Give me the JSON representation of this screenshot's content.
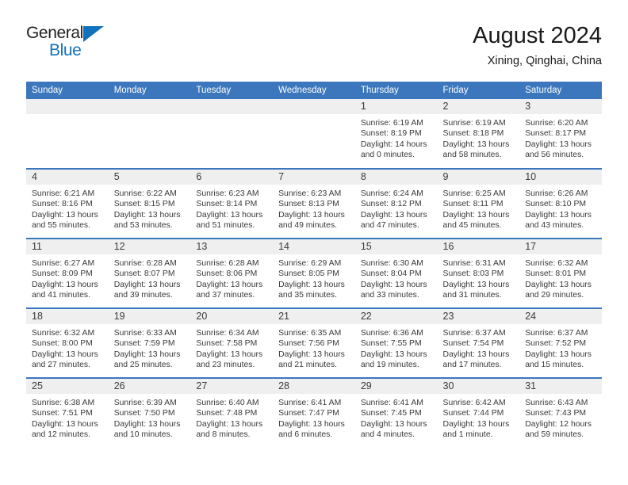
{
  "brand": {
    "name_line1": "General",
    "name_line2": "Blue",
    "accent_color": "#1272bc"
  },
  "header": {
    "title": "August 2024",
    "location": "Xining, Qinghai, China"
  },
  "theme": {
    "header_blue": "#3c77bd",
    "daynum_band": "#efefef",
    "text": "#3a3a3a"
  },
  "weekday_headers": [
    "Sunday",
    "Monday",
    "Tuesday",
    "Wednesday",
    "Thursday",
    "Friday",
    "Saturday"
  ],
  "labels": {
    "sunrise_prefix": "Sunrise:",
    "sunset_prefix": "Sunset:",
    "daylight_prefix": "Daylight:"
  },
  "weeks": [
    [
      {
        "empty": true
      },
      {
        "empty": true
      },
      {
        "empty": true
      },
      {
        "empty": true
      },
      {
        "day": "1",
        "sunrise": "Sunrise: 6:19 AM",
        "sunset": "Sunset: 8:19 PM",
        "daylight": "Daylight: 14 hours and 0 minutes."
      },
      {
        "day": "2",
        "sunrise": "Sunrise: 6:19 AM",
        "sunset": "Sunset: 8:18 PM",
        "daylight": "Daylight: 13 hours and 58 minutes."
      },
      {
        "day": "3",
        "sunrise": "Sunrise: 6:20 AM",
        "sunset": "Sunset: 8:17 PM",
        "daylight": "Daylight: 13 hours and 56 minutes."
      }
    ],
    [
      {
        "day": "4",
        "sunrise": "Sunrise: 6:21 AM",
        "sunset": "Sunset: 8:16 PM",
        "daylight": "Daylight: 13 hours and 55 minutes."
      },
      {
        "day": "5",
        "sunrise": "Sunrise: 6:22 AM",
        "sunset": "Sunset: 8:15 PM",
        "daylight": "Daylight: 13 hours and 53 minutes."
      },
      {
        "day": "6",
        "sunrise": "Sunrise: 6:23 AM",
        "sunset": "Sunset: 8:14 PM",
        "daylight": "Daylight: 13 hours and 51 minutes."
      },
      {
        "day": "7",
        "sunrise": "Sunrise: 6:23 AM",
        "sunset": "Sunset: 8:13 PM",
        "daylight": "Daylight: 13 hours and 49 minutes."
      },
      {
        "day": "8",
        "sunrise": "Sunrise: 6:24 AM",
        "sunset": "Sunset: 8:12 PM",
        "daylight": "Daylight: 13 hours and 47 minutes."
      },
      {
        "day": "9",
        "sunrise": "Sunrise: 6:25 AM",
        "sunset": "Sunset: 8:11 PM",
        "daylight": "Daylight: 13 hours and 45 minutes."
      },
      {
        "day": "10",
        "sunrise": "Sunrise: 6:26 AM",
        "sunset": "Sunset: 8:10 PM",
        "daylight": "Daylight: 13 hours and 43 minutes."
      }
    ],
    [
      {
        "day": "11",
        "sunrise": "Sunrise: 6:27 AM",
        "sunset": "Sunset: 8:09 PM",
        "daylight": "Daylight: 13 hours and 41 minutes."
      },
      {
        "day": "12",
        "sunrise": "Sunrise: 6:28 AM",
        "sunset": "Sunset: 8:07 PM",
        "daylight": "Daylight: 13 hours and 39 minutes."
      },
      {
        "day": "13",
        "sunrise": "Sunrise: 6:28 AM",
        "sunset": "Sunset: 8:06 PM",
        "daylight": "Daylight: 13 hours and 37 minutes."
      },
      {
        "day": "14",
        "sunrise": "Sunrise: 6:29 AM",
        "sunset": "Sunset: 8:05 PM",
        "daylight": "Daylight: 13 hours and 35 minutes."
      },
      {
        "day": "15",
        "sunrise": "Sunrise: 6:30 AM",
        "sunset": "Sunset: 8:04 PM",
        "daylight": "Daylight: 13 hours and 33 minutes."
      },
      {
        "day": "16",
        "sunrise": "Sunrise: 6:31 AM",
        "sunset": "Sunset: 8:03 PM",
        "daylight": "Daylight: 13 hours and 31 minutes."
      },
      {
        "day": "17",
        "sunrise": "Sunrise: 6:32 AM",
        "sunset": "Sunset: 8:01 PM",
        "daylight": "Daylight: 13 hours and 29 minutes."
      }
    ],
    [
      {
        "day": "18",
        "sunrise": "Sunrise: 6:32 AM",
        "sunset": "Sunset: 8:00 PM",
        "daylight": "Daylight: 13 hours and 27 minutes."
      },
      {
        "day": "19",
        "sunrise": "Sunrise: 6:33 AM",
        "sunset": "Sunset: 7:59 PM",
        "daylight": "Daylight: 13 hours and 25 minutes."
      },
      {
        "day": "20",
        "sunrise": "Sunrise: 6:34 AM",
        "sunset": "Sunset: 7:58 PM",
        "daylight": "Daylight: 13 hours and 23 minutes."
      },
      {
        "day": "21",
        "sunrise": "Sunrise: 6:35 AM",
        "sunset": "Sunset: 7:56 PM",
        "daylight": "Daylight: 13 hours and 21 minutes."
      },
      {
        "day": "22",
        "sunrise": "Sunrise: 6:36 AM",
        "sunset": "Sunset: 7:55 PM",
        "daylight": "Daylight: 13 hours and 19 minutes."
      },
      {
        "day": "23",
        "sunrise": "Sunrise: 6:37 AM",
        "sunset": "Sunset: 7:54 PM",
        "daylight": "Daylight: 13 hours and 17 minutes."
      },
      {
        "day": "24",
        "sunrise": "Sunrise: 6:37 AM",
        "sunset": "Sunset: 7:52 PM",
        "daylight": "Daylight: 13 hours and 15 minutes."
      }
    ],
    [
      {
        "day": "25",
        "sunrise": "Sunrise: 6:38 AM",
        "sunset": "Sunset: 7:51 PM",
        "daylight": "Daylight: 13 hours and 12 minutes."
      },
      {
        "day": "26",
        "sunrise": "Sunrise: 6:39 AM",
        "sunset": "Sunset: 7:50 PM",
        "daylight": "Daylight: 13 hours and 10 minutes."
      },
      {
        "day": "27",
        "sunrise": "Sunrise: 6:40 AM",
        "sunset": "Sunset: 7:48 PM",
        "daylight": "Daylight: 13 hours and 8 minutes."
      },
      {
        "day": "28",
        "sunrise": "Sunrise: 6:41 AM",
        "sunset": "Sunset: 7:47 PM",
        "daylight": "Daylight: 13 hours and 6 minutes."
      },
      {
        "day": "29",
        "sunrise": "Sunrise: 6:41 AM",
        "sunset": "Sunset: 7:45 PM",
        "daylight": "Daylight: 13 hours and 4 minutes."
      },
      {
        "day": "30",
        "sunrise": "Sunrise: 6:42 AM",
        "sunset": "Sunset: 7:44 PM",
        "daylight": "Daylight: 13 hours and 1 minute."
      },
      {
        "day": "31",
        "sunrise": "Sunrise: 6:43 AM",
        "sunset": "Sunset: 7:43 PM",
        "daylight": "Daylight: 12 hours and 59 minutes."
      }
    ]
  ]
}
